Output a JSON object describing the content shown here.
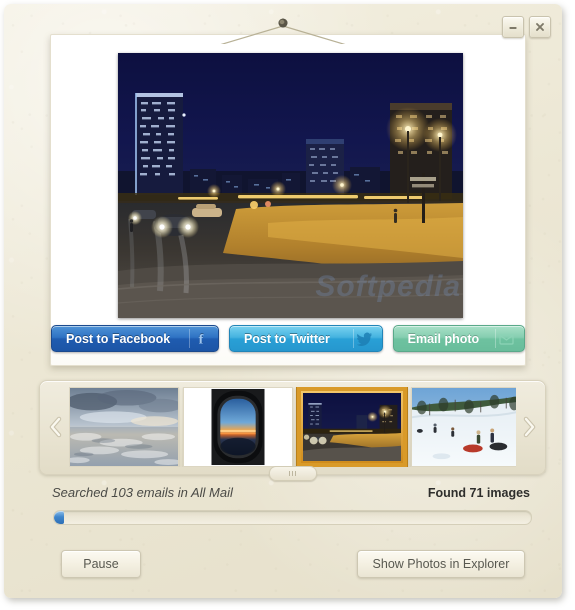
{
  "window": {
    "controls": [
      {
        "name": "minimize-button",
        "glyph": "minimize"
      },
      {
        "name": "close-button",
        "glyph": "close"
      }
    ]
  },
  "photo_viewer": {
    "watermark": "Softpedia",
    "current_photo": {
      "alt": "Night cityscape with lit streets, skyscrapers and cars",
      "index": 3
    },
    "share_buttons": [
      {
        "id": "facebook",
        "label": "Post to Facebook",
        "icon": "facebook-icon",
        "color": "#1f5cb0"
      },
      {
        "id": "twitter",
        "label": "Post to Twitter",
        "icon": "twitter-bird-icon",
        "color": "#29a0d6"
      },
      {
        "id": "email",
        "label": "Email photo",
        "icon": "envelope-icon",
        "color": "#6ec2a0"
      }
    ]
  },
  "thumbnails": {
    "prev_icon": "chevron-left-icon",
    "next_icon": "chevron-right-icon",
    "items": [
      {
        "id": "clouds",
        "alt": "Aerial view of clouds over sea",
        "selected": false
      },
      {
        "id": "airplane-window",
        "alt": "Sunset seen through an airplane window",
        "selected": false
      },
      {
        "id": "city-night",
        "alt": "Night cityscape with lit streets",
        "selected": true
      },
      {
        "id": "snow-hill",
        "alt": "People sledding on a snowy hill",
        "selected": false
      }
    ]
  },
  "status": {
    "searched_text": "Searched 103 emails in All Mail",
    "found_text": "Found 71 images",
    "emails_searched": 103,
    "mailbox": "All Mail",
    "images_found": 71,
    "progress_percent": 2,
    "progress_color": "#2f6fb5"
  },
  "footer": {
    "pause_label": "Pause",
    "explorer_label": "Show Photos in Explorer"
  }
}
